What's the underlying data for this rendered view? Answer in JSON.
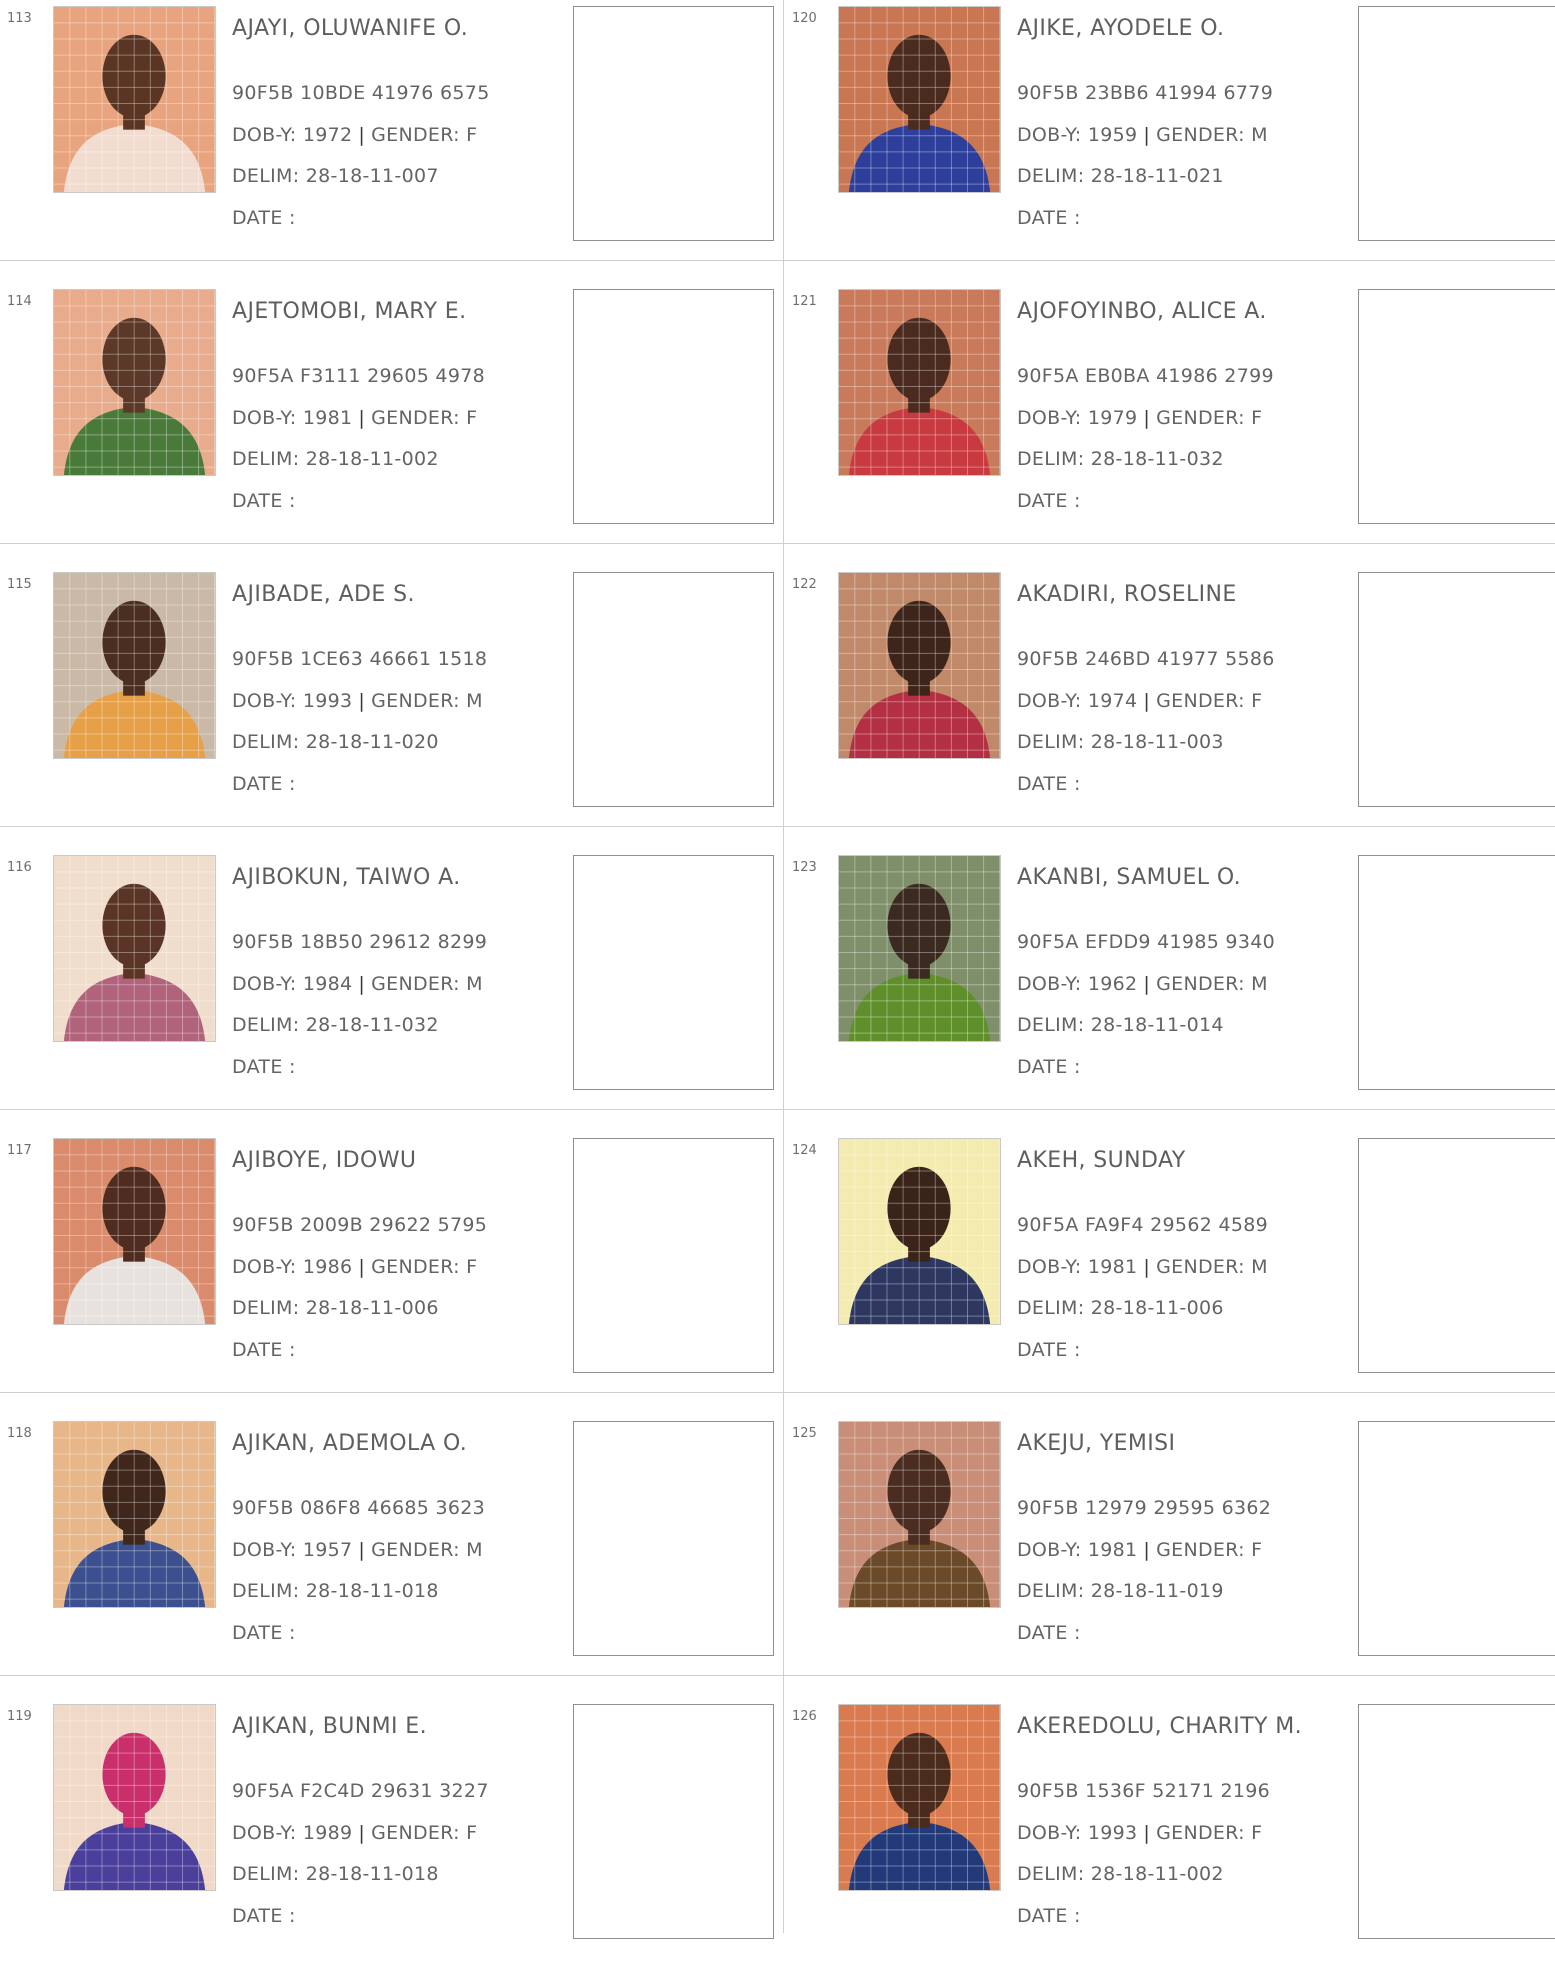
{
  "entries": [
    {
      "number": "113",
      "name": "AJAYI, OLUWANIFE O.",
      "vin": "90F5B 10BDE 41976 6575",
      "dob_label": "DOB-Y:",
      "dob": "1972",
      "gender_label": "GENDER:",
      "gender": "F",
      "delim_label": "DELIM:",
      "delim": "28-18-11-007",
      "date_label": "DATE  :",
      "photo_bg": "#e8a47e",
      "photo_cloth": "#f2dcd0",
      "photo_skin": "#5a3524"
    },
    {
      "number": "114",
      "name": "AJETOMOBI, MARY E.",
      "vin": "90F5A F3111 29605 4978",
      "dob_label": "DOB-Y:",
      "dob": "1981",
      "gender_label": "GENDER:",
      "gender": "F",
      "delim_label": "DELIM:",
      "delim": "28-18-11-002",
      "date_label": "DATE  :",
      "photo_bg": "#e8ab8c",
      "photo_cloth": "#4a7a3a",
      "photo_skin": "#5b3827"
    },
    {
      "number": "115",
      "name": "AJIBADE, ADE S.",
      "vin": "90F5B 1CE63 46661 1518",
      "dob_label": "DOB-Y:",
      "dob": "1993",
      "gender_label": "GENDER:",
      "gender": "M",
      "delim_label": "DELIM:",
      "delim": "28-18-11-020",
      "date_label": "DATE  :",
      "photo_bg": "#c9b9a6",
      "photo_cloth": "#e6a047",
      "photo_skin": "#4a2e20"
    },
    {
      "number": "116",
      "name": "AJIBOKUN, TAIWO A.",
      "vin": "90F5B 18B50 29612 8299",
      "dob_label": "DOB-Y:",
      "dob": "1984",
      "gender_label": "GENDER:",
      "gender": "M",
      "delim_label": "DELIM:",
      "delim": "28-18-11-032",
      "date_label": "DATE  :",
      "photo_bg": "#f0ddcc",
      "photo_cloth": "#b0637a",
      "photo_skin": "#5a3525"
    },
    {
      "number": "117",
      "name": "AJIBOYE, IDOWU",
      "vin": "90F5B 2009B 29622 5795",
      "dob_label": "DOB-Y:",
      "dob": "1986",
      "gender_label": "GENDER:",
      "gender": "F",
      "delim_label": "DELIM:",
      "delim": "28-18-11-006",
      "date_label": "DATE  :",
      "photo_bg": "#d98b6c",
      "photo_cloth": "#e8e2de",
      "photo_skin": "#4e2c1f"
    },
    {
      "number": "118",
      "name": "AJIKAN, ADEMOLA O.",
      "vin": "90F5B 086F8 46685 3623",
      "dob_label": "DOB-Y:",
      "dob": "1957",
      "gender_label": "GENDER:",
      "gender": "M",
      "delim_label": "DELIM:",
      "delim": "28-18-11-018",
      "date_label": "DATE  :",
      "photo_bg": "#e7b78a",
      "photo_cloth": "#3c4f8f",
      "photo_skin": "#3f271c"
    },
    {
      "number": "119",
      "name": "AJIKAN, BUNMI E.",
      "vin": "90F5A F2C4D 29631 3227",
      "dob_label": "DOB-Y:",
      "dob": "1989",
      "gender_label": "GENDER:",
      "gender": "F",
      "delim_label": "DELIM:",
      "delim": "28-18-11-018",
      "date_label": "DATE  :",
      "photo_bg": "#f1d9c8",
      "photo_cloth": "#4a3f9a",
      "photo_skin": "#c9306b"
    },
    {
      "number": "120",
      "name": "AJIKE, AYODELE O.",
      "vin": "90F5B 23BB6 41994 6779",
      "dob_label": "DOB-Y:",
      "dob": "1959",
      "gender_label": "GENDER:",
      "gender": "M",
      "delim_label": "DELIM:",
      "delim": "28-18-11-021",
      "date_label": "DATE  :",
      "photo_bg": "#c97652",
      "photo_cloth": "#2d3f9a",
      "photo_skin": "#4a2b1e"
    },
    {
      "number": "121",
      "name": "AJOFOYINBO, ALICE A.",
      "vin": "90F5A EB0BA 41986 2799",
      "dob_label": "DOB-Y:",
      "dob": "1979",
      "gender_label": "GENDER:",
      "gender": "F",
      "delim_label": "DELIM:",
      "delim": "28-18-11-032",
      "date_label": "DATE  :",
      "photo_bg": "#c87a5a",
      "photo_cloth": "#c83a3f",
      "photo_skin": "#4b2b1f"
    },
    {
      "number": "122",
      "name": "AKADIRI, ROSELINE",
      "vin": "90F5B 246BD 41977 5586",
      "dob_label": "DOB-Y:",
      "dob": "1974",
      "gender_label": "GENDER:",
      "gender": "F",
      "delim_label": "DELIM:",
      "delim": "28-18-11-003",
      "date_label": "DATE  :",
      "photo_bg": "#c08a6a",
      "photo_cloth": "#b23042",
      "photo_skin": "#3d251b"
    },
    {
      "number": "123",
      "name": "AKANBI, SAMUEL O.",
      "vin": "90F5A EFDD9 41985 9340",
      "dob_label": "DOB-Y:",
      "dob": "1962",
      "gender_label": "GENDER:",
      "gender": "M",
      "delim_label": "DELIM:",
      "delim": "28-18-11-014",
      "date_label": "DATE  :",
      "photo_bg": "#7f8f6a",
      "photo_cloth": "#5f8f2a",
      "photo_skin": "#3a2a20"
    },
    {
      "number": "124",
      "name": "AKEH, SUNDAY",
      "vin": "90F5A FA9F4 29562 4589",
      "dob_label": "DOB-Y:",
      "dob": "1981",
      "gender_label": "GENDER:",
      "gender": "M",
      "delim_label": "DELIM:",
      "delim": "28-18-11-006",
      "date_label": "DATE  :",
      "photo_bg": "#f4ebb0",
      "photo_cloth": "#2d3760",
      "photo_skin": "#3a2419"
    },
    {
      "number": "125",
      "name": "AKEJU, YEMISI",
      "vin": "90F5B 12979 29595 6362",
      "dob_label": "DOB-Y:",
      "dob": "1981",
      "gender_label": "GENDER:",
      "gender": "F",
      "delim_label": "DELIM:",
      "delim": "28-18-11-019",
      "date_label": "DATE  :",
      "photo_bg": "#c98e78",
      "photo_cloth": "#6b4a2a",
      "photo_skin": "#4a2c20"
    },
    {
      "number": "126",
      "name": "AKEREDOLU, CHARITY M.",
      "vin": "90F5B 1536F 52171 2196",
      "dob_label": "DOB-Y:",
      "dob": "1993",
      "gender_label": "GENDER:",
      "gender": "F",
      "delim_label": "DELIM:",
      "delim": "28-18-11-002",
      "date_label": "DATE  :",
      "photo_bg": "#d97a4f",
      "photo_cloth": "#223a7a",
      "photo_skin": "#4b2b1c"
    }
  ]
}
